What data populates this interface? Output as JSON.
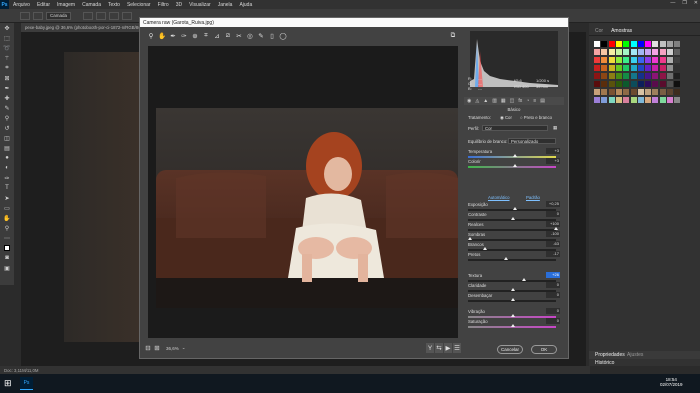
{
  "menubar": {
    "logo": "Ps",
    "items": [
      "Arquivo",
      "Editar",
      "Imagem",
      "Camada",
      "Texto",
      "Selecionar",
      "Filtro",
      "3D",
      "Visualizar",
      "Janela",
      "Ajuda"
    ],
    "window_controls": [
      "—",
      "❐",
      "✕"
    ]
  },
  "options": {
    "select": "Camada"
  },
  "tabs": [
    "pexe-baby.jpeg @ 36,6% (photobooth-por-ci-1872-n/RGB/8#) ×",
    "Camera.jpeg @ 12,7% (RGB/8#) ×"
  ],
  "status": {
    "text": "Doc: 3,11M/11,0M"
  },
  "dialog": {
    "title": "Camera raw (Garota_Ruiva.jpg)",
    "camera_info": {
      "f": "f/5,6",
      "speed": "1/200 s",
      "iso": "ISO 400",
      "lens": "35 mm",
      "r_label": "R:",
      "g_label": "G:",
      "b_label": "B:",
      "r_val": "---",
      "g_val": "---",
      "b_val": "---"
    },
    "panel_title": "Básico",
    "tratamento_label": "Tratamento:",
    "tratamento_opt1": "Cor",
    "tratamento_opt2": "Preto e branco",
    "perfil_label": "Perfil:",
    "perfil_value": "Cor",
    "wb_label": "Equilíbrio de branco:",
    "wb_value": "Personalizado",
    "auto_label": "Automático",
    "default_label": "Padrão",
    "sliders": [
      {
        "label": "Temperatura",
        "value": "+3",
        "pos": 0.52
      },
      {
        "label": "Colorir",
        "value": "+3",
        "pos": 0.52
      },
      {
        "label": "Exposição",
        "value": "+0,25",
        "pos": 0.52
      },
      {
        "label": "Contraste",
        "value": "0",
        "pos": 0.5
      },
      {
        "label": "Realces",
        "value": "+100",
        "pos": 1.0
      },
      {
        "label": "Sombras",
        "value": "-100",
        "pos": 0.0
      },
      {
        "label": "Brancos",
        "value": "-63",
        "pos": 0.18
      },
      {
        "label": "Pretos",
        "value": "-17",
        "pos": 0.42
      },
      {
        "label": "Textura",
        "value": "+26",
        "pos": 0.63
      },
      {
        "label": "Claridade",
        "value": "0",
        "pos": 0.5
      },
      {
        "label": "Desembaçar",
        "value": "0",
        "pos": 0.5
      },
      {
        "label": "Vibração",
        "value": "0",
        "pos": 0.5
      },
      {
        "label": "Saturação",
        "value": "0",
        "pos": 0.5
      }
    ],
    "zoom": "36,6%",
    "cancel": "Cancelar",
    "ok": "OK"
  },
  "rpanel": {
    "tabs": [
      "Cor",
      "Amostras"
    ],
    "bottom_tabs": [
      "Propriedades",
      "Ajustes"
    ],
    "bottom2": "Histórico"
  },
  "taskbar": {
    "time": "18:54",
    "date": "02/07/2019"
  },
  "colors": {
    "accent": "#31a8ff"
  }
}
